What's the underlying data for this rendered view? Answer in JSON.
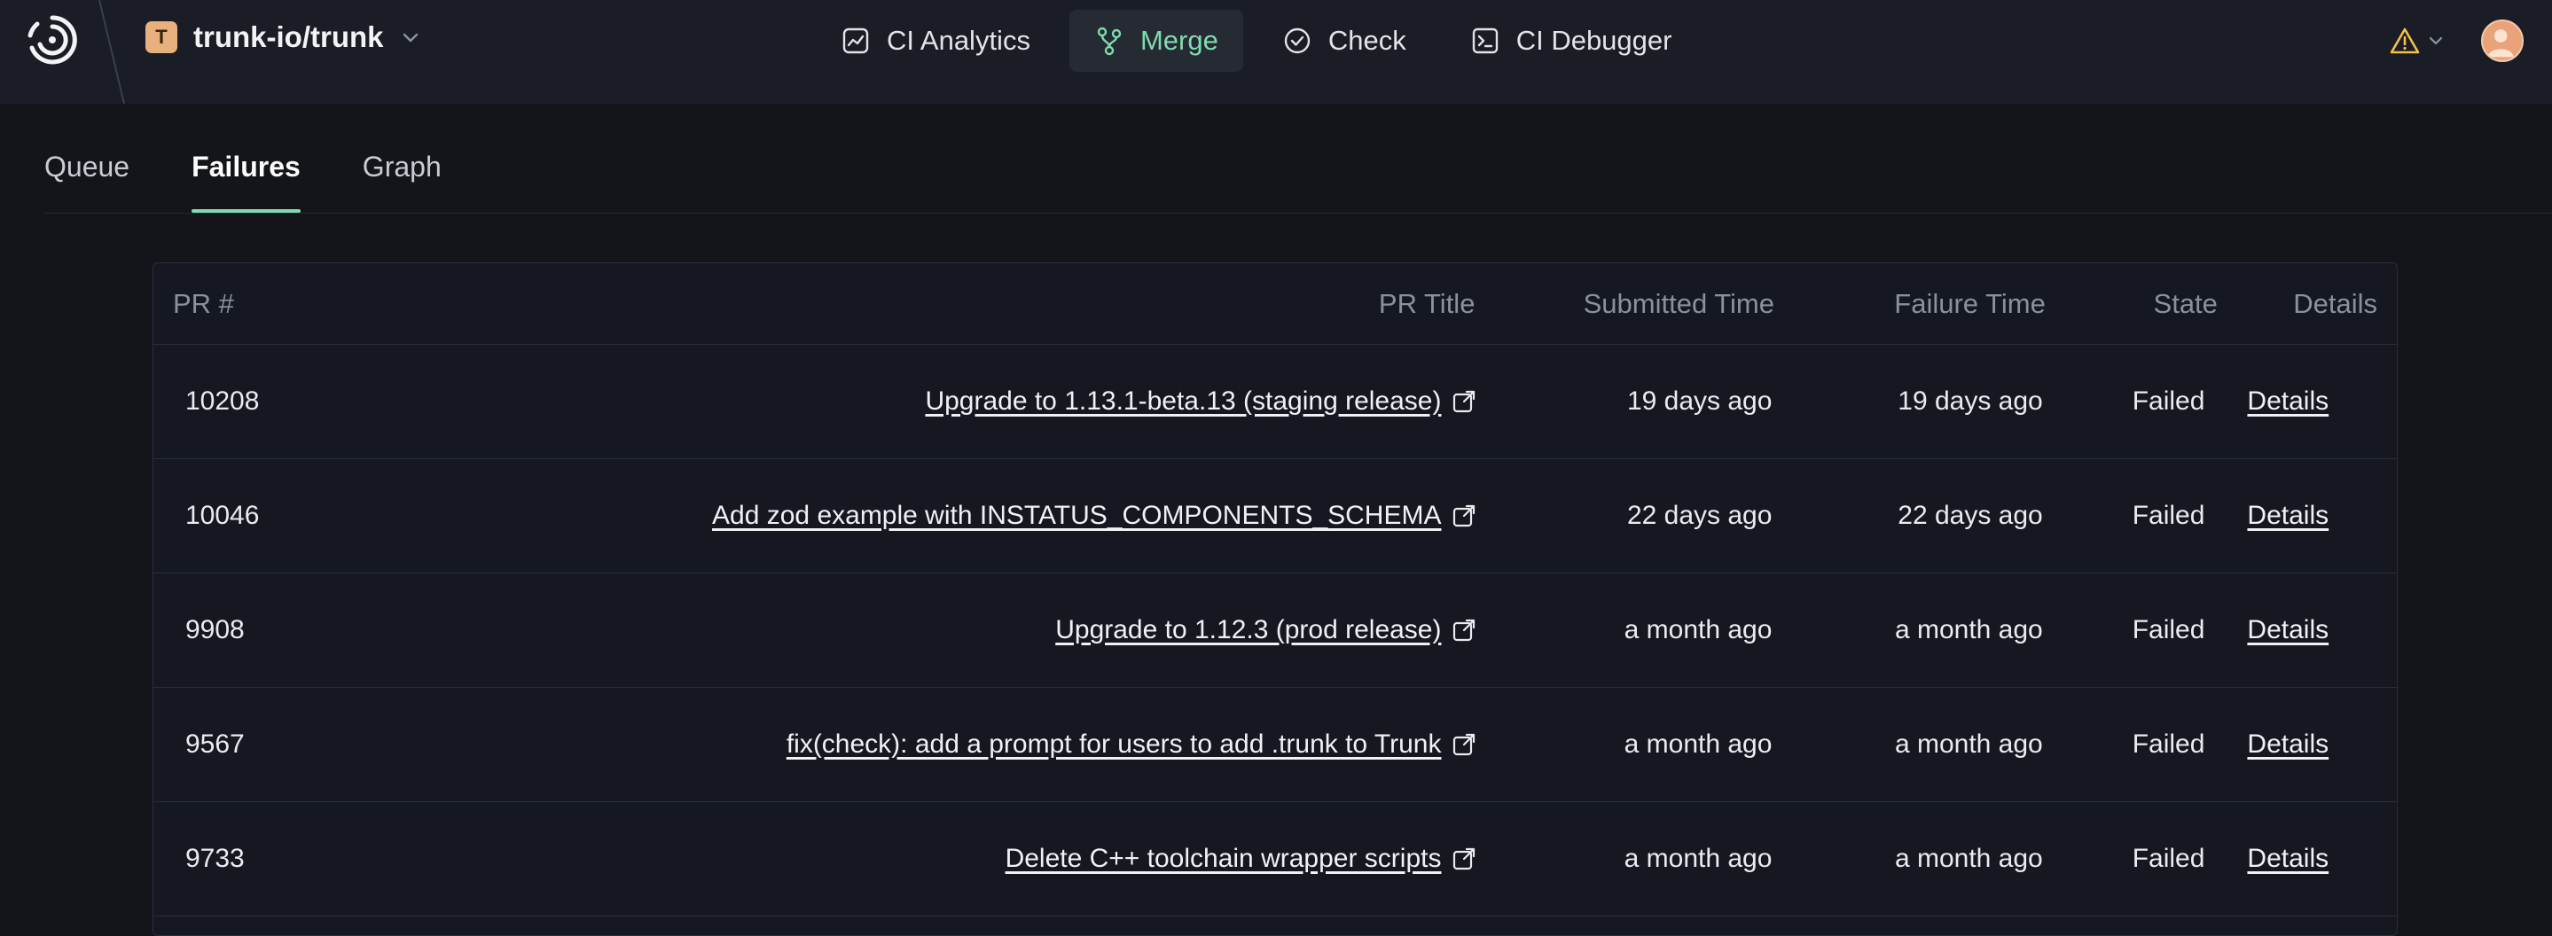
{
  "header": {
    "org_initial": "T",
    "org_name": "trunk-io/trunk",
    "nav": [
      {
        "label": "CI Analytics",
        "icon": "chart-icon",
        "active": false
      },
      {
        "label": "Merge",
        "icon": "merge-icon",
        "active": true
      },
      {
        "label": "Check",
        "icon": "check-circle-icon",
        "active": false
      },
      {
        "label": "CI Debugger",
        "icon": "terminal-icon",
        "active": false
      }
    ]
  },
  "tabs": [
    {
      "label": "Queue",
      "active": false
    },
    {
      "label": "Failures",
      "active": true
    },
    {
      "label": "Graph",
      "active": false
    }
  ],
  "table": {
    "columns": [
      "PR #",
      "PR Title",
      "Submitted Time",
      "Failure Time",
      "State",
      "Details"
    ],
    "rows": [
      {
        "pr": "10208",
        "title": "Upgrade to 1.13.1-beta.13 (staging release)",
        "submitted": "19 days ago",
        "failed": "19 days ago",
        "state": "Failed",
        "details": "Details"
      },
      {
        "pr": "10046",
        "title": "Add zod example with INSTATUS_COMPONENTS_SCHEMA",
        "submitted": "22 days ago",
        "failed": "22 days ago",
        "state": "Failed",
        "details": "Details"
      },
      {
        "pr": "9908",
        "title": "Upgrade to 1.12.3 (prod release)",
        "submitted": "a month ago",
        "failed": "a month ago",
        "state": "Failed",
        "details": "Details"
      },
      {
        "pr": "9567",
        "title": "fix(check): add a prompt for users to add .trunk to Trunk",
        "submitted": "a month ago",
        "failed": "a month ago",
        "state": "Failed",
        "details": "Details"
      },
      {
        "pr": "9733",
        "title": "Delete C++ toolchain wrapper scripts",
        "submitted": "a month ago",
        "failed": "a month ago",
        "state": "Failed",
        "details": "Details"
      }
    ]
  },
  "colors": {
    "background": "#13151b",
    "topbar": "#1a1d25",
    "accent": "#7fdcae",
    "warning": "#f0c24a",
    "org_badge": "#e8b07e"
  }
}
